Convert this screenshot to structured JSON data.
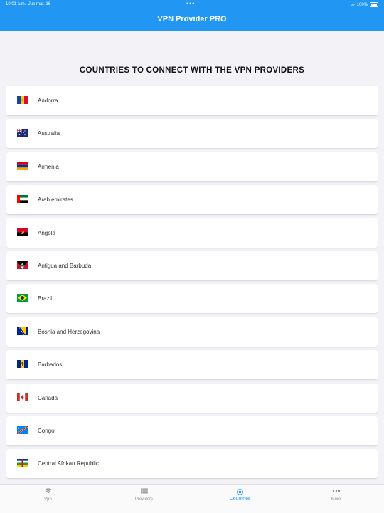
{
  "status_bar": {
    "time": "10:01 a.m.",
    "date": "Jue mar. 16",
    "battery": "100%"
  },
  "app": {
    "title": "VPN Provider PRO"
  },
  "section_title": "COUNTRIES TO CONNECT WITH THE VPN PROVIDERS",
  "countries": [
    {
      "name": "Andorra",
      "flag_icon": "andorra-flag-icon"
    },
    {
      "name": "Australia",
      "flag_icon": "australia-flag-icon"
    },
    {
      "name": "Armenia",
      "flag_icon": "armenia-flag-icon"
    },
    {
      "name": "Arab emirates",
      "flag_icon": "uae-flag-icon"
    },
    {
      "name": "Angola",
      "flag_icon": "angola-flag-icon"
    },
    {
      "name": "Antigua and Barbuda",
      "flag_icon": "antigua-flag-icon"
    },
    {
      "name": "Brazil",
      "flag_icon": "brazil-flag-icon"
    },
    {
      "name": "Bosnia and Herzegovina",
      "flag_icon": "bosnia-flag-icon"
    },
    {
      "name": "Barbados",
      "flag_icon": "barbados-flag-icon"
    },
    {
      "name": "Canada",
      "flag_icon": "canada-flag-icon"
    },
    {
      "name": "Congo",
      "flag_icon": "congo-flag-icon"
    },
    {
      "name": "Central Afrikan Republic",
      "flag_icon": "car-flag-icon"
    }
  ],
  "tabs": [
    {
      "label": "Vpn",
      "icon": "wifi-icon",
      "active": false
    },
    {
      "label": "Providers",
      "icon": "list-icon",
      "active": false
    },
    {
      "label": "Countries",
      "icon": "target-icon",
      "active": true
    },
    {
      "label": "More",
      "icon": "more-icon",
      "active": false
    }
  ],
  "colors": {
    "accent": "#2196f3",
    "background": "#f2f2f7",
    "inactive_tab": "#8e8e93"
  }
}
